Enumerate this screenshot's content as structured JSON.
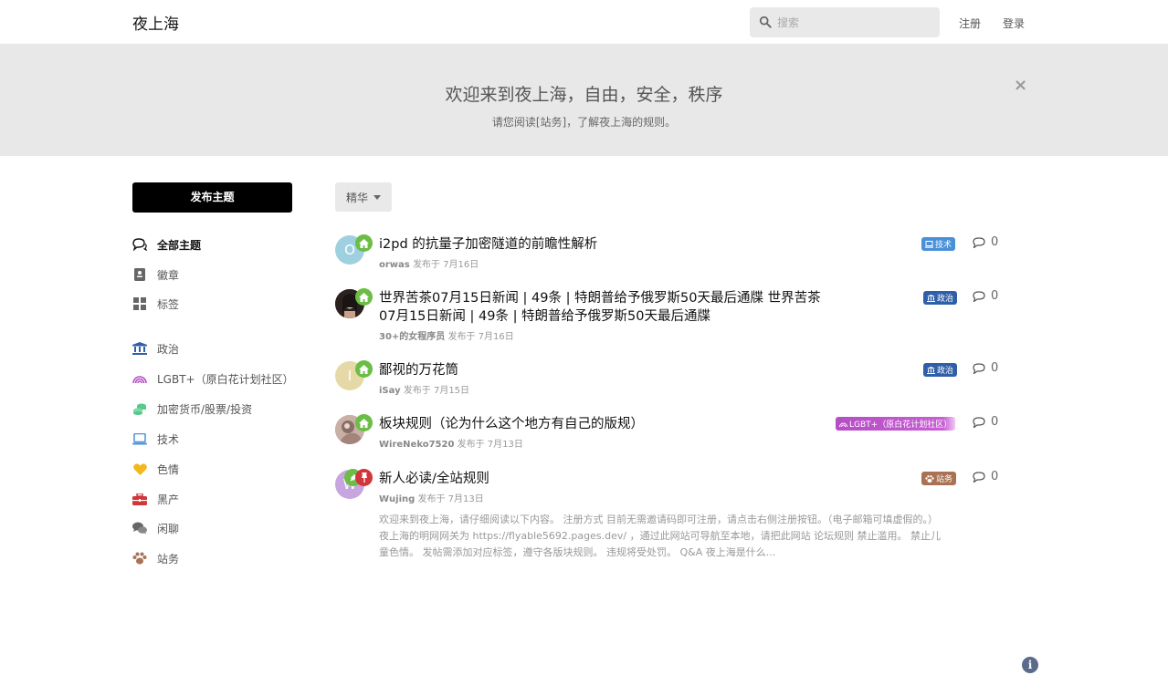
{
  "header": {
    "site_title": "夜上海",
    "search_placeholder": "搜索",
    "signup": "注册",
    "login": "登录"
  },
  "hero": {
    "title": "欢迎来到夜上海，自由，安全，秩序",
    "subtitle": "请您阅读[站务]，了解夜上海的规则。",
    "close": "×"
  },
  "sidebar": {
    "post_button": "发布主题",
    "items": [
      {
        "label": "全部主题",
        "icon": "comments-icon"
      },
      {
        "label": "徽章",
        "icon": "badge-icon"
      },
      {
        "label": "标签",
        "icon": "tags-grid-icon"
      },
      {
        "label": "政治",
        "icon": "landmark-icon"
      },
      {
        "label": "LGBT+（原白花计划社区）",
        "icon": "rainbow-icon"
      },
      {
        "label": "加密货币/股票/投资",
        "icon": "coins-icon"
      },
      {
        "label": "技术",
        "icon": "laptop-icon"
      },
      {
        "label": "色情",
        "icon": "heart-icon"
      },
      {
        "label": "黑产",
        "icon": "toolbox-icon"
      },
      {
        "label": "闲聊",
        "icon": "chat-icon"
      },
      {
        "label": "站务",
        "icon": "paw-icon"
      }
    ]
  },
  "filter": {
    "label": "精华"
  },
  "discussions": [
    {
      "title": "i2pd 的抗量子加密隧道的前瞻性解析",
      "user": "orwas",
      "meta": "发布于 7月16日",
      "avatar_letter": "O",
      "tag": "技术",
      "replies": "0"
    },
    {
      "title": "世界苦茶07月15日新闻 | 49条 | 特朗普给予俄罗斯50天最后通牒 世界苦茶07月15日新闻 | 49条 | 特朗普给予俄罗斯50天最后通牒",
      "user": "30+的女程序员",
      "meta": "发布于 7月16日",
      "avatar_letter": "",
      "tag": "政治",
      "replies": "0"
    },
    {
      "title": "鄙视的万花筒",
      "user": "iSay",
      "meta": "发布于 7月15日",
      "avatar_letter": "I",
      "tag": "政治",
      "replies": "0"
    },
    {
      "title": "板块规则（论为什么这个地方有自己的版规）",
      "user": "WireNeko7520",
      "meta": "发布于 7月13日",
      "avatar_letter": "",
      "tag": "LGBT+（原白花计划社区）",
      "replies": "0"
    },
    {
      "title": "新人必读/全站规则",
      "user": "Wujing",
      "meta": "发布于 7月13日",
      "avatar_letter": "W",
      "tag": "站务",
      "replies": "0",
      "excerpt": "欢迎来到夜上海，请仔细阅读以下内容。 注册方式 目前无需邀请码即可注册，请点击右侧注册按钮。（电子邮箱可填虚假的。） 夜上海的明网网关为 https://flyable5692.pages.dev/ ，通过此网站可导航至本地，请把此网站 论坛规则 禁止滥用。 禁止儿童色情。 发帖需添加对应标签，遵守各版块规则。 违规将受处罚。 Q&A 夜上海是什么..."
    }
  ],
  "colors": {
    "tag_tech": "#4a90d9",
    "tag_politics": "#2f5fa8",
    "tag_lgbt": "#b54dc4",
    "tag_site": "#a97254",
    "badge_home": "#6bbd45",
    "badge_pin": "#d0363a"
  }
}
